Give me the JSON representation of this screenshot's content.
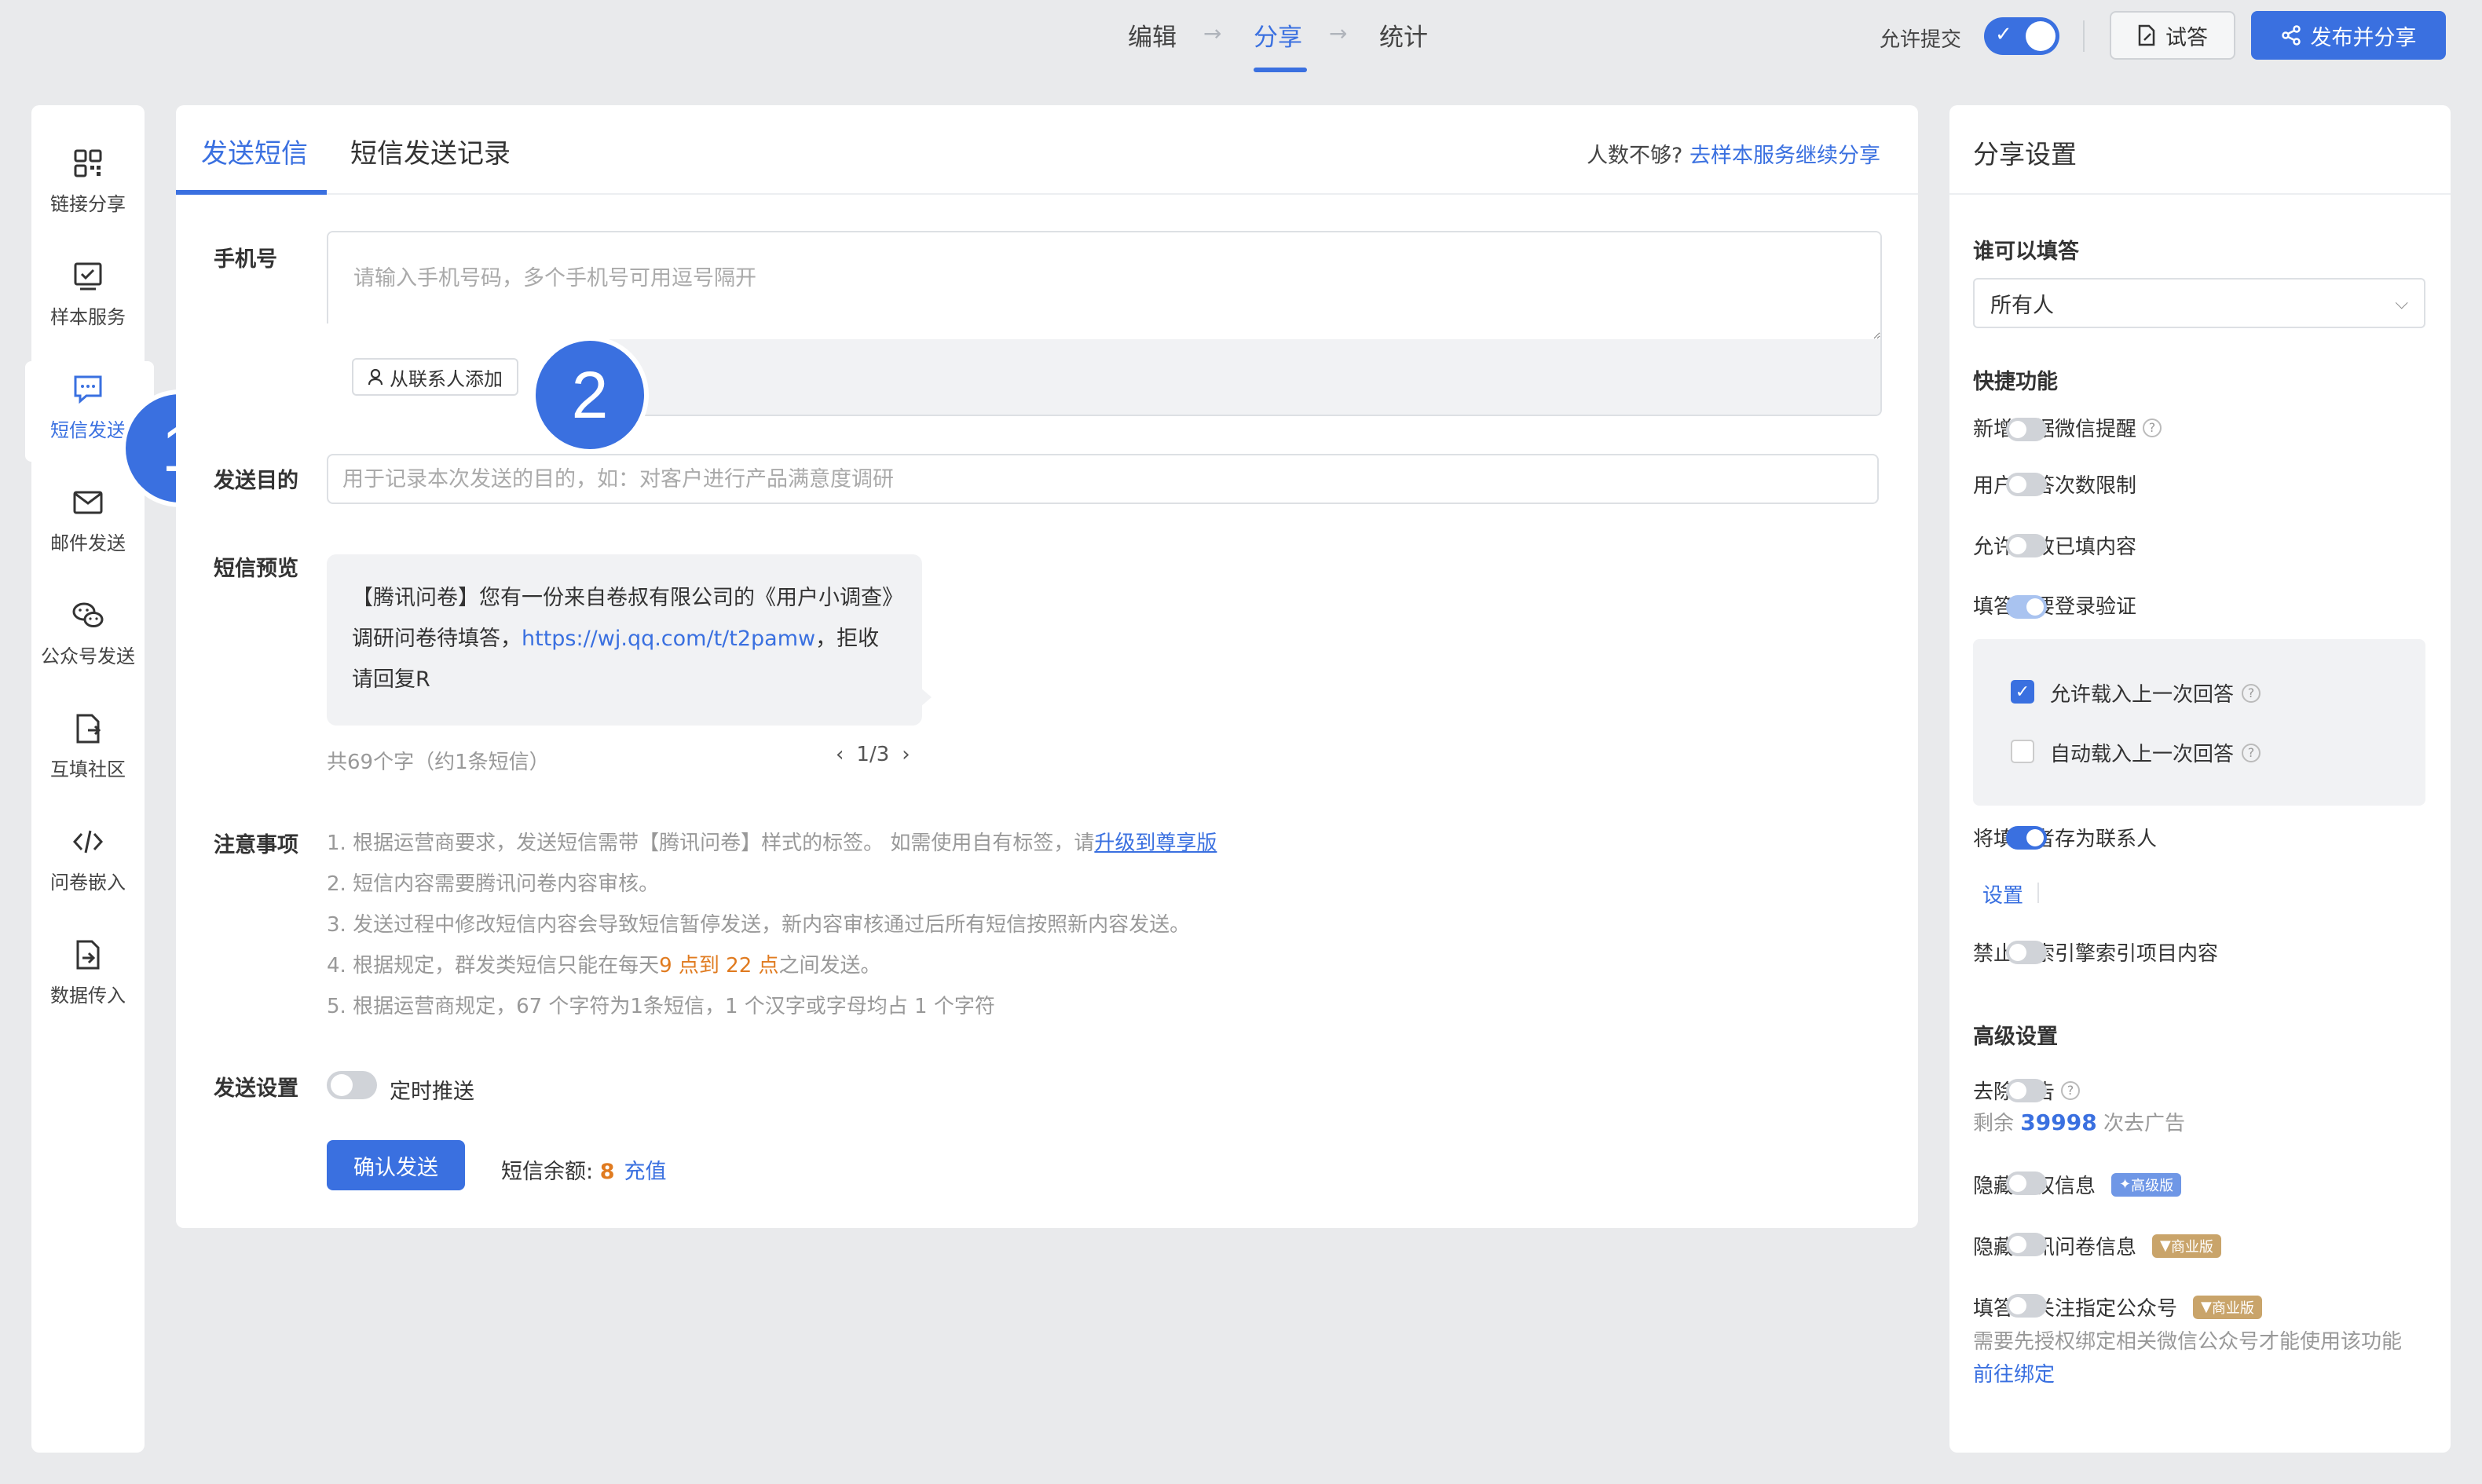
{
  "steps": {
    "edit": "编辑",
    "share": "分享",
    "stats": "统计"
  },
  "header": {
    "allow_submit_label": "允许提交",
    "allow_submit_on": true,
    "try_label": "试答",
    "publish_label": "发布并分享"
  },
  "sidebar": {
    "items": [
      {
        "label": "链接分享",
        "icon": "qrcode-icon"
      },
      {
        "label": "样本服务",
        "icon": "sample-check-icon"
      },
      {
        "label": "短信发送",
        "icon": "sms-icon",
        "active": true
      },
      {
        "label": "邮件发送",
        "icon": "mail-icon"
      },
      {
        "label": "公众号发送",
        "icon": "wechat-icon"
      },
      {
        "label": "互填社区",
        "icon": "community-doc-icon"
      },
      {
        "label": "问卷嵌入",
        "icon": "code-embed-icon"
      },
      {
        "label": "数据传入",
        "icon": "data-import-icon"
      }
    ]
  },
  "annotations": {
    "step1": "1",
    "step2": "2"
  },
  "main": {
    "tabs": [
      {
        "label": "发送短信",
        "active": true
      },
      {
        "label": "短信发送记录"
      }
    ],
    "more_hint_text": "人数不够?",
    "more_hint_link": "去样本服务继续分享",
    "phone": {
      "label": "手机号",
      "placeholder": "请输入手机号码，多个手机号可用逗号隔开",
      "add_contact_label": "从联系人添加"
    },
    "purpose": {
      "label": "发送目的",
      "placeholder": "用于记录本次发送的目的，如：对客户进行产品满意度调研"
    },
    "preview": {
      "label": "短信预览",
      "text_before": "【腾讯问卷】您有一份来自卷叔有限公司的《用户小调查》调研问卷待填答，",
      "link": "https://wj.qq.com/t/t2pamw",
      "text_after": "，拒收请回复R",
      "char_count": "共69个字（约1条短信）",
      "pager": "1/3"
    },
    "notes": {
      "label": "注意事项",
      "n1_a": "1. 根据运营商要求，发送短信需带【腾讯问卷】样式的标签。 如需使用自有标签，请",
      "n1_link": "升级到尊享版",
      "n2": "2. 短信内容需要腾讯问卷内容审核。",
      "n3": "3. 发送过程中修改短信内容会导致短信暂停发送，新内容审核通过后所有短信按照新内容发送。",
      "n4_a": "4. 根据规定，群发类短信只能在每天",
      "n4_hl": "9 点到 22 点",
      "n4_b": "之间发送。",
      "n5": "5. 根据运营商规定，67 个字符为1条短信，1 个汉字或字母均占 1 个字符"
    },
    "send_settings": {
      "label": "发送设置",
      "schedule_label": "定时推送",
      "schedule_on": false
    },
    "send_button": "确认发送",
    "balance_label": "短信余额:",
    "balance_value": "8",
    "recharge_label": "充值"
  },
  "right": {
    "title": "分享设置",
    "who_label": "谁可以填答",
    "who_value": "所有人",
    "quick_label": "快捷功能",
    "quick": [
      {
        "label": "新增数据微信提醒",
        "help": true,
        "on": false
      },
      {
        "label": "用户填答次数限制",
        "on": false
      },
      {
        "label": "允许修改已填内容",
        "on": false
      },
      {
        "label": "填答需要登录验证",
        "on": true
      }
    ],
    "login_options": [
      {
        "label": "允许载入上一次回答",
        "checked": true
      },
      {
        "label": "自动载入上一次回答",
        "checked": false
      }
    ],
    "save_contact_label": "将填答者存为联系人",
    "save_contact_on": true,
    "contact_settings": "设置",
    "no_index_label": "禁止搜索引擎索引项目内容",
    "no_index_on": false,
    "advanced_label": "高级设置",
    "remove_ads_label": "去除广告",
    "remove_ads_prefix": "剩余",
    "remove_ads_count": "39998",
    "remove_ads_suffix": "次去广告",
    "hide_copyright_label": "隐藏版权信息",
    "hide_copyright_tag": "高级版",
    "hide_tencent_label": "隐藏腾讯问卷信息",
    "hide_tencent_tag": "商业版",
    "follow_label": "填答需关注指定公众号",
    "follow_tag": "商业版",
    "follow_desc": "需要先授权绑定相关微信公众号才能使用该功能",
    "follow_link": "前往绑定"
  },
  "colors": {
    "accent": "#3a70e0",
    "highlight": "#e07b20"
  }
}
